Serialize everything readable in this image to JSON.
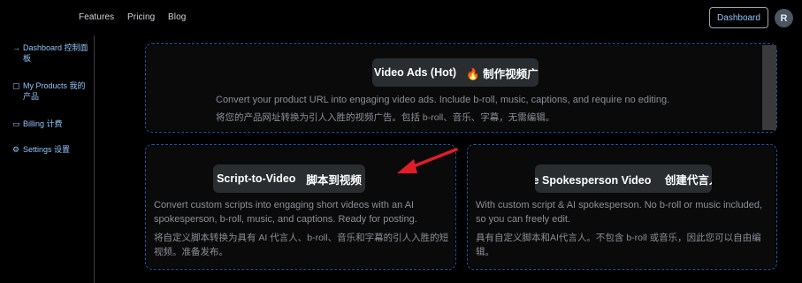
{
  "nav": {
    "features": "Features",
    "pricing": "Pricing",
    "blog": "Blog",
    "dashboard_button": "Dashboard",
    "avatar_letter": "R"
  },
  "sidebar": {
    "items": [
      {
        "icon": "arrow-right-icon",
        "label": "Dashboard 控制面板"
      },
      {
        "icon": "product-icon",
        "label": "My Products 我的产品"
      },
      {
        "icon": "card-icon",
        "label": "Billing 计费"
      },
      {
        "icon": "gear-icon",
        "label": "Settings 设置"
      }
    ]
  },
  "cards": {
    "video_ads": {
      "title": "Video Ads (Hot)",
      "title_zh": "🔥 制作视频广告",
      "desc_en": "Convert your product URL into engaging video ads. Include b-roll, music, captions, and require no editing.",
      "desc_zh": "将您的产品网址转换为引人入胜的视频广告。包括 b-roll、音乐、字幕，无需编辑。"
    },
    "script_to_video": {
      "title": "Script-to-Video",
      "title_zh": "脚本到视频",
      "desc_en": "Convert custom scripts into engaging short videos with an AI spokesperson, b-roll, music, and captions. Ready for posting.",
      "desc_zh": "将自定义脚本转换为具有 AI 代言人、b-roll、音乐和字幕的引人入胜的短视频。准备发布。"
    },
    "spokesperson": {
      "title": "Create Spokesperson Video",
      "title_zh": "创建代言人视频",
      "desc_en": "With custom script & AI spokesperson. No b-roll or music included, so you can freely edit.",
      "desc_zh": "具有自定义脚本和AI代言人。不包含 b-roll 或音乐，因此您可以自由编辑。"
    }
  },
  "colors": {
    "accent": "#93c5fd",
    "card_border": "#1e5aa8",
    "arrow": "#e11d2a"
  }
}
